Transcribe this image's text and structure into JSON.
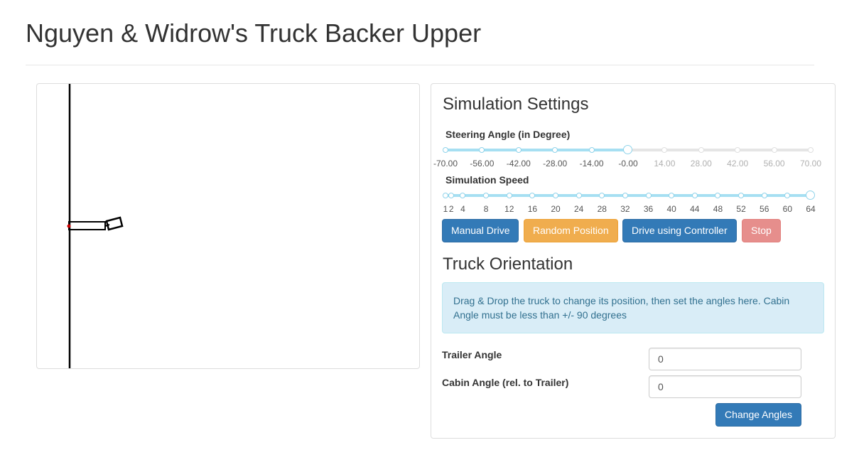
{
  "page": {
    "title": "Nguyen & Widrow's Truck Backer Upper"
  },
  "settings": {
    "heading": "Simulation Settings",
    "steering": {
      "label": "Steering Angle (in Degree)",
      "ticks": [
        "-70.00",
        "-56.00",
        "-42.00",
        "-28.00",
        "-14.00",
        "-0.00",
        "14.00",
        "28.00",
        "42.00",
        "56.00",
        "70.00"
      ],
      "value": "-0.00",
      "min": -70,
      "max": 70,
      "current": 0
    },
    "speed": {
      "label": "Simulation Speed",
      "ticks": [
        "1",
        "2",
        "4",
        "8",
        "12",
        "16",
        "20",
        "24",
        "28",
        "32",
        "36",
        "40",
        "44",
        "48",
        "52",
        "56",
        "60",
        "64"
      ],
      "value": "64",
      "min": 1,
      "max": 64,
      "current": 64
    },
    "buttons": {
      "manual": "Manual Drive",
      "random": "Random Position",
      "controller": "Drive using Controller",
      "stop": "Stop"
    }
  },
  "orientation": {
    "heading": "Truck Orientation",
    "info": "Drag & Drop the truck to change its position, then set the angles here. Cabin Angle must be less than +/- 90 degrees",
    "trailer_label": "Trailer Angle",
    "trailer_value": "0",
    "cabin_label": "Cabin Angle (rel. to Trailer)",
    "cabin_value": "0",
    "change_button": "Change Angles"
  },
  "colors": {
    "primary": "#337ab7",
    "warning": "#f0ad4e",
    "danger": "#d9534f",
    "slider_fill": "#a6dff2",
    "info_bg": "#d9edf7",
    "info_text": "#31708f",
    "truck_rear_marker": "#cc0000"
  },
  "icons": {
    "truck": "truck-trailer-outline",
    "dock": "loading-dock-line"
  }
}
